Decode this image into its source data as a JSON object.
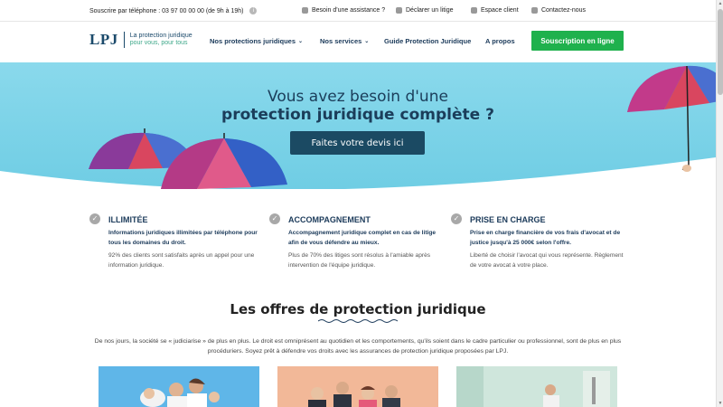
{
  "topbar": {
    "phone": "Souscrire par téléphone : 03 97 00 00 00 (de 9h à 19h)",
    "links": [
      {
        "label": "Besoin d'une assistance ?",
        "icon": "chat-icon"
      },
      {
        "label": "Déclarer un litige",
        "icon": "flag-icon"
      },
      {
        "label": "Espace client",
        "icon": "user-icon"
      },
      {
        "label": "Contactez-nous",
        "icon": "mail-icon"
      }
    ]
  },
  "header": {
    "logo": "LPJ",
    "tagline_1": "La protection juridique",
    "tagline_2": "pour vous, pour tous",
    "nav": [
      {
        "label": "Nos protections juridiques",
        "has_menu": true
      },
      {
        "label": "Nos services",
        "has_menu": true
      },
      {
        "label": "Guide Protection Juridique",
        "has_menu": false
      },
      {
        "label": "A propos",
        "has_menu": false
      }
    ],
    "cta": "Souscription en ligne"
  },
  "hero": {
    "title_line1": "Vous avez besoin d'une",
    "title_line2": "protection juridique complète ?",
    "button": "Faites votre devis ici"
  },
  "features": [
    {
      "title": "ILLIMITÉE",
      "bold": "Informations juridiques illimitées par téléphone pour tous les domaines du droit.",
      "desc": "92% des clients sont satisfaits après un appel pour une information juridique."
    },
    {
      "title": "ACCOMPAGNEMENT",
      "bold": "Accompagnement juridique complet en cas de litige afin de vous défendre au mieux.",
      "desc": "Plus de 70% des litiges sont résolus à l'amiable après intervention de l'équipe juridique."
    },
    {
      "title": "PRISE EN CHARGE",
      "bold": "Prise en charge financière de vos frais d'avocat et de justice jusqu'à 25 000€ selon l'offre.",
      "desc": "Liberté de choisir l'avocat qui vous représente. Règlement de votre avocat à votre place."
    }
  ],
  "offers": {
    "title": "Les offres de protection juridique",
    "intro": "De nos jours, la société se « judiciarise » de plus en plus. Le droit est omniprésent au quotidien et les comportements, qu'ils soient dans le cadre particulier ou professionnel, sont de plus en plus procéduriers. Soyez prêt à défendre vos droits avec les assurances de protection juridique proposées par LPJ."
  },
  "colors": {
    "navy": "#1b3a5a",
    "green": "#1fb14d",
    "sky": "#7fd3e8",
    "button_dark": "#1b4a63"
  }
}
